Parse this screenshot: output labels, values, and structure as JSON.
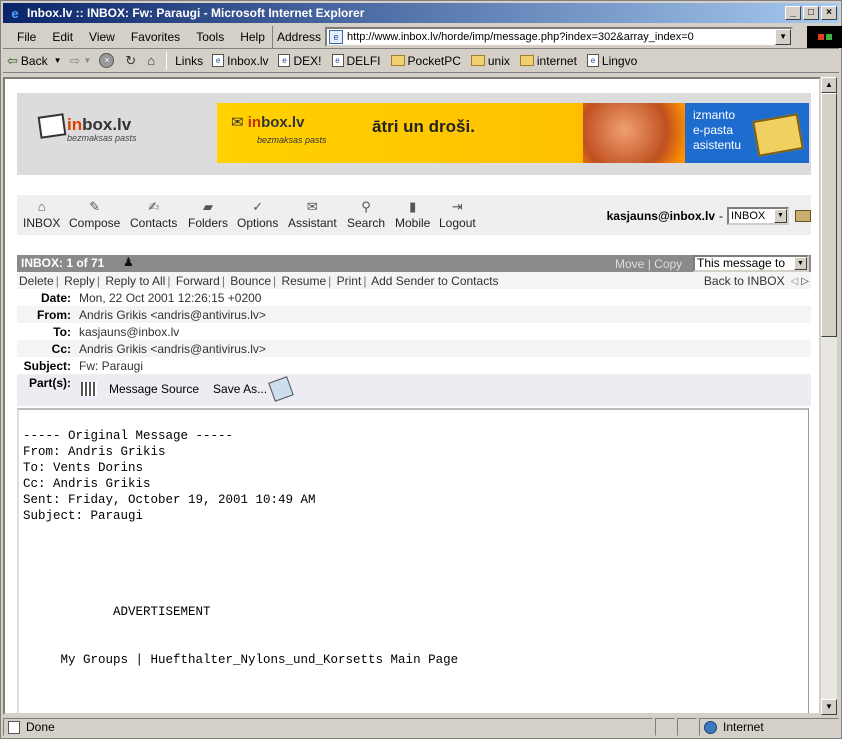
{
  "window": {
    "title": "Inbox.lv :: INBOX: Fw: Paraugi - Microsoft Internet Explorer",
    "min": "_",
    "max": "□",
    "close": "×"
  },
  "menu": [
    "File",
    "Edit",
    "View",
    "Favorites",
    "Tools",
    "Help"
  ],
  "address": {
    "label": "Address",
    "url": "http://www.inbox.lv/horde/imp/message.php?index=302&array_index=0"
  },
  "toolbar": {
    "back": "Back",
    "links_label": "Links",
    "links": [
      "Inbox.lv",
      "DEX!",
      "DELFI",
      "PocketPC",
      "unix",
      "internet",
      "Lingvo"
    ]
  },
  "status": {
    "text": "Done",
    "zone": "Internet"
  },
  "banner": {
    "logo_brand_in": "in",
    "logo_brand_rest": "box.lv",
    "logo_sub": "bezmaksas pasts",
    "ad_logo_in": "in",
    "ad_logo_rest": "box.lv",
    "ad_sub": "bezmaksas pasts",
    "ad_slogan": "ātri un droši.",
    "ad_blue_lines": [
      "izmanto",
      "e-pasta",
      "asistentu"
    ]
  },
  "nav": {
    "items": [
      "INBOX",
      "Compose",
      "Contacts",
      "Folders",
      "Options",
      "Assistant",
      "Search",
      "Mobile",
      "Logout"
    ],
    "user_email": "kasjauns@inbox.lv",
    "user_sep": "-",
    "mailbox": "INBOX"
  },
  "message_bar": {
    "count": "INBOX: 1 of 71",
    "move": "Move",
    "copy": "Copy",
    "sep": "|",
    "target": "This message to"
  },
  "actions": {
    "items": [
      "Delete",
      "Reply",
      "Reply to All",
      "Forward",
      "Bounce",
      "Resume",
      "Print",
      "Add Sender to Contacts"
    ],
    "back_to_inbox": "Back to INBOX"
  },
  "headers": {
    "date_label": "Date:",
    "date": "Mon, 22 Oct 2001 12:26:15 +0200",
    "from_label": "From:",
    "from": "Andris Grikis <andris@antivirus.lv>",
    "to_label": "To:",
    "to": "kasjauns@inbox.lv",
    "cc_label": "Cc:",
    "cc": "Andris Grikis <andris@antivirus.lv>",
    "subject_label": "Subject:",
    "subject": "Fw: Paraugi",
    "parts_label": "Part(s):",
    "message_source": "Message Source",
    "save_as": "Save As..."
  },
  "body": "----- Original Message -----\nFrom: Andris Grikis\nTo: Vents Dorins\nCc: Andris Grikis\nSent: Friday, October 19, 2001 10:49 AM\nSubject: Paraugi\n\n\n\n\n\n            ADVERTISEMENT\n\n\n     My Groups | Huefthalter_Nylons_und_Korsetts Main Page"
}
